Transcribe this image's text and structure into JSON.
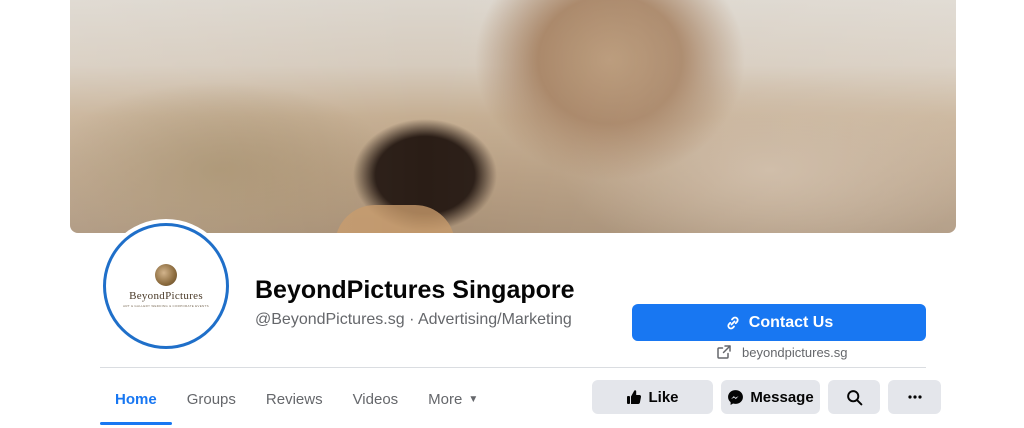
{
  "page": {
    "name": "BeyondPictures Singapore",
    "meta": "@BeyondPictures.sg · Advertising/Marketing",
    "logo_text": "BeyondPictures",
    "logo_subtext": "ART & GALLERY WEDDING & CORPORATE EVENTS"
  },
  "cta": {
    "contact_label": "Contact Us",
    "website": "beyondpictures.sg"
  },
  "tabs": [
    {
      "label": "Home",
      "active": true
    },
    {
      "label": "Groups"
    },
    {
      "label": "Reviews"
    },
    {
      "label": "Videos"
    },
    {
      "label": "More"
    }
  ],
  "actions": {
    "like_label": "Like",
    "message_label": "Message"
  },
  "colors": {
    "accent": "#1877f2",
    "avatar_ring": "#1f6fc9",
    "button_gray": "#e4e6eb"
  },
  "icons": [
    "link-icon",
    "external-link-icon",
    "thumbs-up-icon",
    "messenger-icon",
    "search-icon",
    "ellipsis-icon",
    "caret-down-icon"
  ]
}
